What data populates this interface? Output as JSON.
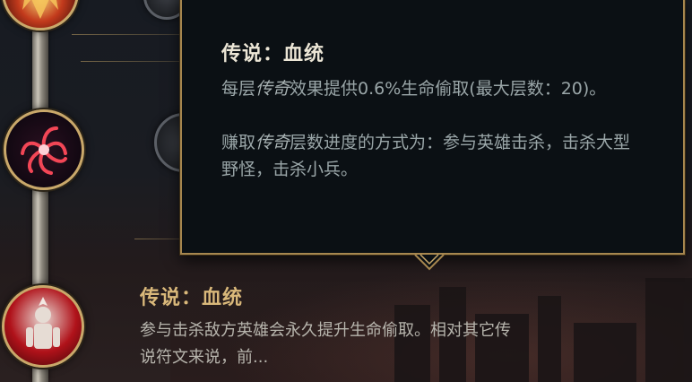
{
  "tooltip": {
    "title": "传说：血统",
    "line1_pre": "每层",
    "line1_em": "传奇",
    "line1_post": "效果提供0.6%生命偷取(最大层数：20)。",
    "line2_pre": "赚取",
    "line2_em": "传奇",
    "line2_post": "层数进度的方式为：参与英雄击杀，击杀大型野怪，击杀小兵。"
  },
  "rune": {
    "name": "传说：血统",
    "description": "参与击杀敌方英雄会永久提升生命偷取。相对其它传说符文来说，前..."
  },
  "colors": {
    "gold_border": "#a7874f",
    "rune_name": "#d9b87a",
    "tooltip_bg": "#0b1014"
  }
}
